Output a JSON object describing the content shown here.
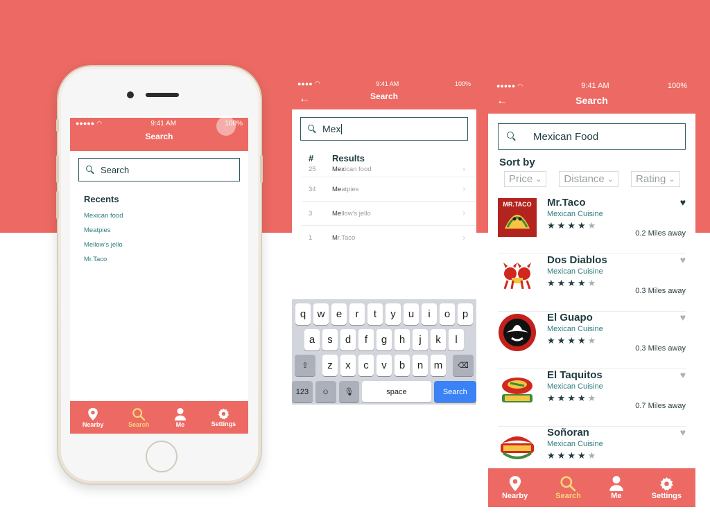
{
  "colors": {
    "brand": "#ec6a63",
    "accent": "#f7d779",
    "text_dark": "#1f3b40",
    "teal": "#2f7d82"
  },
  "status": {
    "time": "9:41 AM",
    "battery": "100%"
  },
  "screen1": {
    "title": "Search",
    "search_placeholder": "Search",
    "recents_title": "Recents",
    "recents": [
      "Mexican food",
      "Meatpies",
      "Mellow's jello",
      "Mr.Taco"
    ]
  },
  "screen2": {
    "title": "Search",
    "query": "Mex",
    "col_count": "#",
    "col_results": "Results",
    "results": [
      {
        "count": "25",
        "match": "Mex",
        "rest": "ican food"
      },
      {
        "count": "34",
        "match": "Me",
        "rest": "atpies"
      },
      {
        "count": "3",
        "match": "Me",
        "rest": "llow's jello"
      },
      {
        "count": "1",
        "match": "M",
        "rest": "r.Taco"
      }
    ],
    "keyboard": {
      "row1": [
        "q",
        "w",
        "e",
        "r",
        "t",
        "y",
        "u",
        "i",
        "o",
        "p"
      ],
      "row2": [
        "a",
        "s",
        "d",
        "f",
        "g",
        "h",
        "j",
        "k",
        "l"
      ],
      "row3": [
        "z",
        "x",
        "c",
        "v",
        "b",
        "n",
        "m"
      ],
      "numbers_key": "123",
      "space_key": "space",
      "return_key": "Search"
    }
  },
  "screen3": {
    "title": "Search",
    "query": "Mexican Food",
    "sort_title": "Sort by",
    "sort_options": [
      "Price",
      "Distance",
      "Rating"
    ],
    "restaurants": [
      {
        "name": "Mr.Taco",
        "cuisine": "Mexican Cuisine",
        "rating": 4,
        "distance": "0.2",
        "distance_unit": "Miles away",
        "favorite": true,
        "logo_icon": "taco-logo"
      },
      {
        "name": "Dos Diablos",
        "cuisine": "Mexican Cuisine",
        "rating": 4,
        "distance": "0.3",
        "distance_unit": "Miles away",
        "favorite": false,
        "logo_icon": "devils-logo"
      },
      {
        "name": "El Guapo",
        "cuisine": "Mexican Cuisine",
        "rating": 4,
        "distance": "0.3",
        "distance_unit": "Miles away",
        "favorite": false,
        "logo_icon": "sombrero-logo"
      },
      {
        "name": "El Taquitos",
        "cuisine": "Mexican Cuisine",
        "rating": 4,
        "distance": "0.7",
        "distance_unit": "Miles away",
        "favorite": false,
        "logo_icon": "taquitos-logo"
      },
      {
        "name": "Soñoran",
        "cuisine": "Mexican Cuisine",
        "rating": 4,
        "distance": "",
        "distance_unit": "",
        "favorite": false,
        "logo_icon": "sonoran-logo"
      }
    ]
  },
  "tabs": [
    {
      "label": "Nearby",
      "icon": "location-pin-icon",
      "active": false
    },
    {
      "label": "Search",
      "icon": "search-icon",
      "active": true
    },
    {
      "label": "Me",
      "icon": "person-icon",
      "active": false
    },
    {
      "label": "Settings",
      "icon": "gear-icon",
      "active": false
    }
  ]
}
